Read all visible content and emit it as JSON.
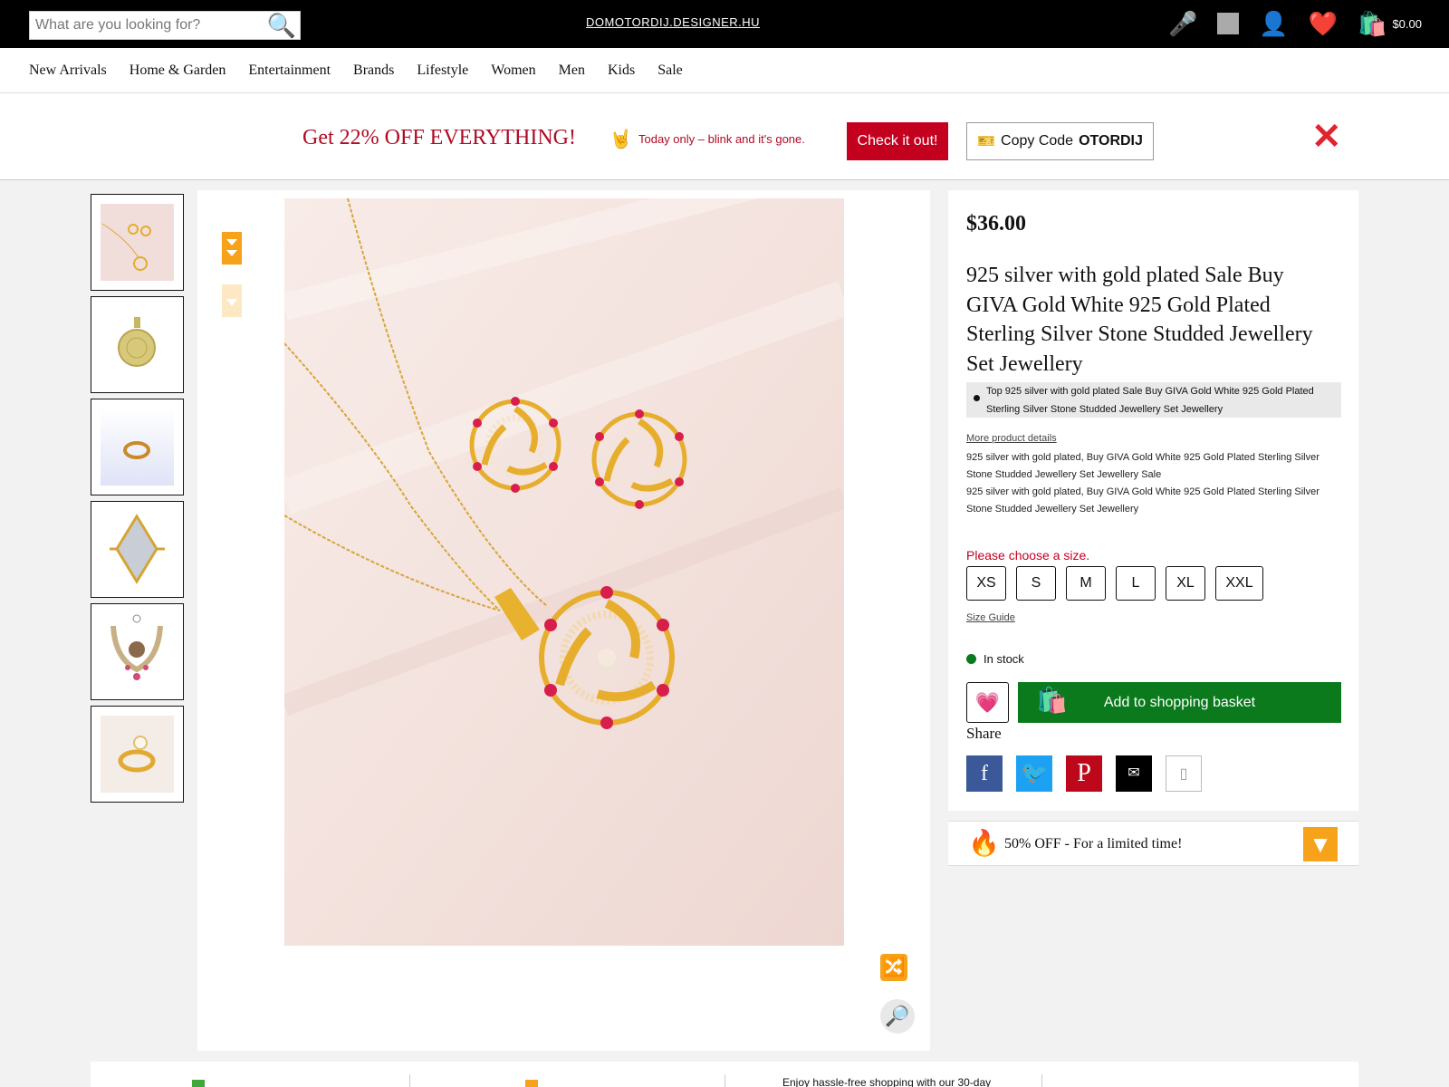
{
  "search": {
    "placeholder": "What are you looking for?"
  },
  "site": {
    "name": "DOMOTORDIJ.DESIGNER.HU"
  },
  "header": {
    "cart_total": "$0.00"
  },
  "nav": {
    "items": [
      "New Arrivals",
      "Home & Garden",
      "Entertainment",
      "Brands",
      "Lifestyle",
      "Women",
      "Men",
      "Kids",
      "Sale"
    ]
  },
  "promo": {
    "title": "Get 22% OFF EVERYTHING!",
    "subtitle": "Today only – blink and it's gone.",
    "cta": "Check it out!",
    "copy_prefix": "Copy Code",
    "code": "OTORDIJ"
  },
  "product": {
    "price": "$36.00",
    "title": "925 silver with gold plated Sale Buy GIVA Gold White 925 Gold Plated Sterling Silver Stone Studded Jewellery Set Jewellery",
    "tag": "Top 925 silver with gold plated Sale Buy GIVA Gold White 925 Gold Plated Sterling Silver Stone Studded Jewellery Set Jewellery",
    "more_details": "More product details",
    "description_1": "925 silver with gold plated, Buy GIVA Gold White 925 Gold Plated Sterling Silver Stone Studded Jewellery Set Jewellery Sale",
    "description_2": "925 silver with gold plated, Buy GIVA Gold White 925 Gold Plated Sterling Silver Stone Studded Jewellery Set Jewellery",
    "size_prompt": "Please choose a size.",
    "sizes": [
      "XS",
      "S",
      "M",
      "L",
      "XL",
      "XXL"
    ],
    "size_guide": "Size Guide",
    "stock": "In stock",
    "add_to_basket": "Add to shopping basket",
    "share_label": "Share"
  },
  "offer": {
    "text": "50% OFF - For a limited time!"
  },
  "footer": {
    "returns_text": "Enjoy hassle-free shopping with our 30-day"
  },
  "colors": {
    "accent_red": "#c4001f",
    "stock_green": "#0a7a1c",
    "arrow_orange": "#f7a21b"
  },
  "icons": {
    "search": "magnifier-icon",
    "mic": "microphone-icon",
    "account": "user-icon",
    "wishlist": "heart-icon",
    "cart": "shopping-bag-icon",
    "close": "red-x-icon",
    "fire": "fire-icon"
  }
}
